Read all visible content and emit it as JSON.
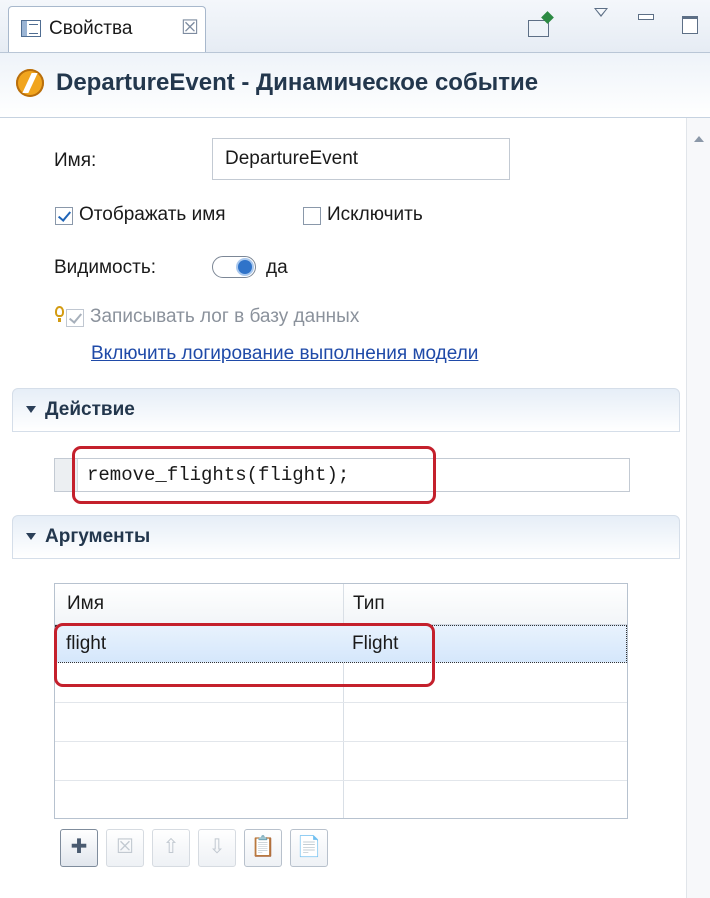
{
  "tab": {
    "label": "Свойства",
    "close_glyph": "☒"
  },
  "toolbar_icons": [
    "pin-view-icon",
    "view-menu-icon",
    "minimize-icon",
    "maximize-icon"
  ],
  "header": {
    "title": "DepartureEvent - Динамическое событие",
    "icon": "dynamic-event-icon"
  },
  "general": {
    "name_label": "Имя:",
    "name_value": "DepartureEvent",
    "show_name_label": "Отображать имя",
    "show_name_checked": true,
    "exclude_label": "Исключить",
    "exclude_checked": false,
    "visibility_label": "Видимость:",
    "visibility_value": "да",
    "log_label": "Записывать лог в базу данных",
    "log_checked": true,
    "log_enabled": false,
    "log_link": "Включить логирование выполнения модели"
  },
  "action": {
    "section_title": "Действие",
    "code": "remove_flights(flight);"
  },
  "arguments": {
    "section_title": "Аргументы",
    "columns": [
      "Имя",
      "Тип"
    ],
    "rows": [
      {
        "name": "flight",
        "type": "Flight"
      }
    ],
    "buttons": [
      {
        "icon": "add-icon",
        "glyph": "✚",
        "enabled": true
      },
      {
        "icon": "delete-icon",
        "glyph": "☒",
        "enabled": false
      },
      {
        "icon": "move-up-icon",
        "glyph": "⇧",
        "enabled": false
      },
      {
        "icon": "move-down-icon",
        "glyph": "⇩",
        "enabled": false
      },
      {
        "icon": "paste-icon",
        "glyph": "📋",
        "enabled": true
      },
      {
        "icon": "copy-icon",
        "glyph": "📄",
        "enabled": true
      }
    ]
  },
  "colors": {
    "highlight": "#c4202c",
    "link": "#1f4aa8",
    "accent": "#2f73c9"
  }
}
